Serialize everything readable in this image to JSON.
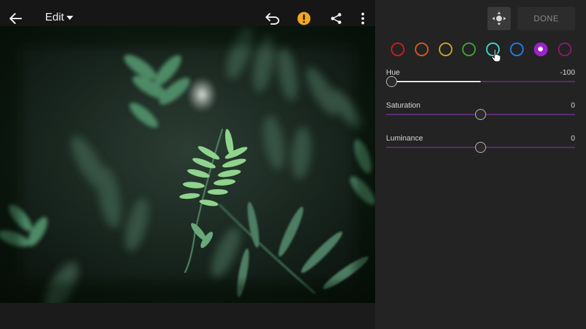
{
  "toolbar": {
    "back_icon": "arrow-left-icon",
    "title": "Edit",
    "dropdown_icon": "caret-down-icon",
    "undo_icon": "undo-icon",
    "warning_icon": "warning-icon",
    "share_icon": "share-icon",
    "more_icon": "more-vertical-icon"
  },
  "panel": {
    "target_adjust_icon": "targeted-adjustment-icon",
    "done_label": "DONE",
    "colors": [
      {
        "name": "red",
        "hex": "#d11a1a",
        "selected": false
      },
      {
        "name": "orange",
        "hex": "#d8561f",
        "selected": false
      },
      {
        "name": "yellow",
        "hex": "#c9a321",
        "selected": false
      },
      {
        "name": "green",
        "hex": "#3fa336",
        "selected": false
      },
      {
        "name": "aqua",
        "hex": "#3fd4cf",
        "selected": false
      },
      {
        "name": "blue",
        "hex": "#1f7fe0",
        "selected": false
      },
      {
        "name": "purple",
        "hex": "#9b22c9",
        "selected": true
      },
      {
        "name": "magenta",
        "hex": "#8a1a6a",
        "selected": false
      }
    ],
    "sliders": [
      {
        "label": "Hue",
        "value": "-100",
        "position": 0.0
      },
      {
        "label": "Saturation",
        "value": "0",
        "position": 0.5
      },
      {
        "label": "Luminance",
        "value": "0",
        "position": 0.5
      }
    ]
  },
  "accent_colors": {
    "warning": "#f2a81d",
    "track": "#5b2c74",
    "panel_bg": "#232323"
  }
}
